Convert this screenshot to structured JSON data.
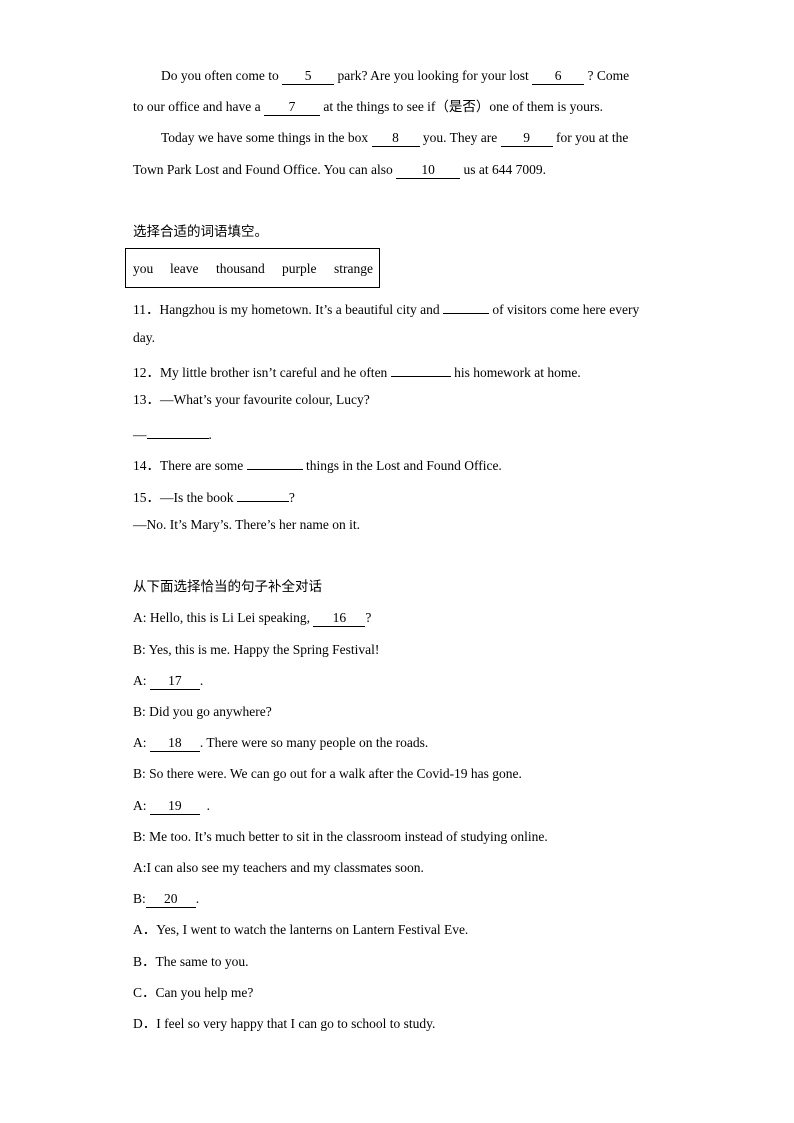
{
  "passage": {
    "lines": [
      [
        {
          "text": "Do you often come to "
        },
        {
          "blank": "5"
        },
        {
          "text": " park? Are you looking for your lost "
        },
        {
          "blank": "6"
        },
        {
          "text": " ? Come"
        }
      ],
      [
        {
          "text": "to our office and have a "
        },
        {
          "blank": "7"
        },
        {
          "text": " at the things to see if（是否）one of them is yours."
        }
      ],
      [
        {
          "text": "Today we have some things in the box "
        },
        {
          "blank": "8"
        },
        {
          "text": " you. They are "
        },
        {
          "blank": "9"
        },
        {
          "text": " for you at the"
        }
      ],
      [
        {
          "text": "Town Park Lost and Found Office. You can also "
        },
        {
          "blank": "10"
        },
        {
          "text": " us at 644 7009."
        }
      ]
    ]
  },
  "section2": {
    "instruction": "选择合适的词语填空。",
    "word_bank": [
      "you",
      "leave",
      "thousand",
      "purple",
      "strange"
    ],
    "lines": [
      [
        {
          "text": "11．Hangzhou is my hometown. It’s a beautiful city and "
        },
        {
          "blank": ""
        },
        {
          "text": " of visitors come here every"
        }
      ],
      [
        {
          "text": "day."
        }
      ],
      [
        {
          "text": "12．My little brother isn’t careful and he often "
        },
        {
          "blank": ""
        },
        {
          "text": " his homework at home."
        }
      ],
      [
        {
          "text": "13．—What’s your favourite colour, Lucy?"
        }
      ],
      [
        {
          "text": "—"
        },
        {
          "blank": ""
        },
        {
          "text": "."
        }
      ],
      [
        {
          "text": "14．There are some "
        },
        {
          "blank": ""
        },
        {
          "text": " things in the Lost and Found Office."
        }
      ],
      [
        {
          "text": "15．—Is the book "
        },
        {
          "blank": ""
        },
        {
          "text": "?"
        }
      ],
      [
        {
          "text": "—No. It’s Mary’s. There’s her name on it."
        }
      ]
    ]
  },
  "section3": {
    "instruction": "从下面选择恰当的句子补全对话",
    "lines": [
      [
        {
          "text": "A: Hello, this is Li Lei speaking, "
        },
        {
          "blank": "16"
        },
        {
          "text": "?"
        }
      ],
      [
        {
          "text": "B: Yes, this is me. Happy the Spring Festival!"
        }
      ],
      [
        {
          "text": "A: "
        },
        {
          "blank": "17"
        },
        {
          "text": "."
        }
      ],
      [
        {
          "text": "B: Did you go anywhere?"
        }
      ],
      [
        {
          "text": "A: "
        },
        {
          "blank": "18"
        },
        {
          "text": ". There were so many people on the roads."
        }
      ],
      [
        {
          "text": "B: So there were. We can go out for a walk after the Covid-19 has gone."
        }
      ],
      [
        {
          "text": "A: "
        },
        {
          "blank": "19"
        },
        {
          "text": "  ."
        }
      ],
      [
        {
          "text": "B: Me too. It’s much better to sit in the classroom instead of studying online."
        }
      ],
      [
        {
          "text": "A:I can also see my teachers and my classmates soon."
        }
      ],
      [
        {
          "text": "B:"
        },
        {
          "blank": "20"
        },
        {
          "text": "."
        }
      ],
      [
        {
          "text": "A．Yes, I went to watch the lanterns on Lantern Festival Eve."
        }
      ],
      [
        {
          "text": "B．The same to you."
        }
      ],
      [
        {
          "text": "C．Can you help me?"
        }
      ],
      [
        {
          "text": "D．I feel so very happy that I can go to school to study."
        }
      ]
    ]
  }
}
